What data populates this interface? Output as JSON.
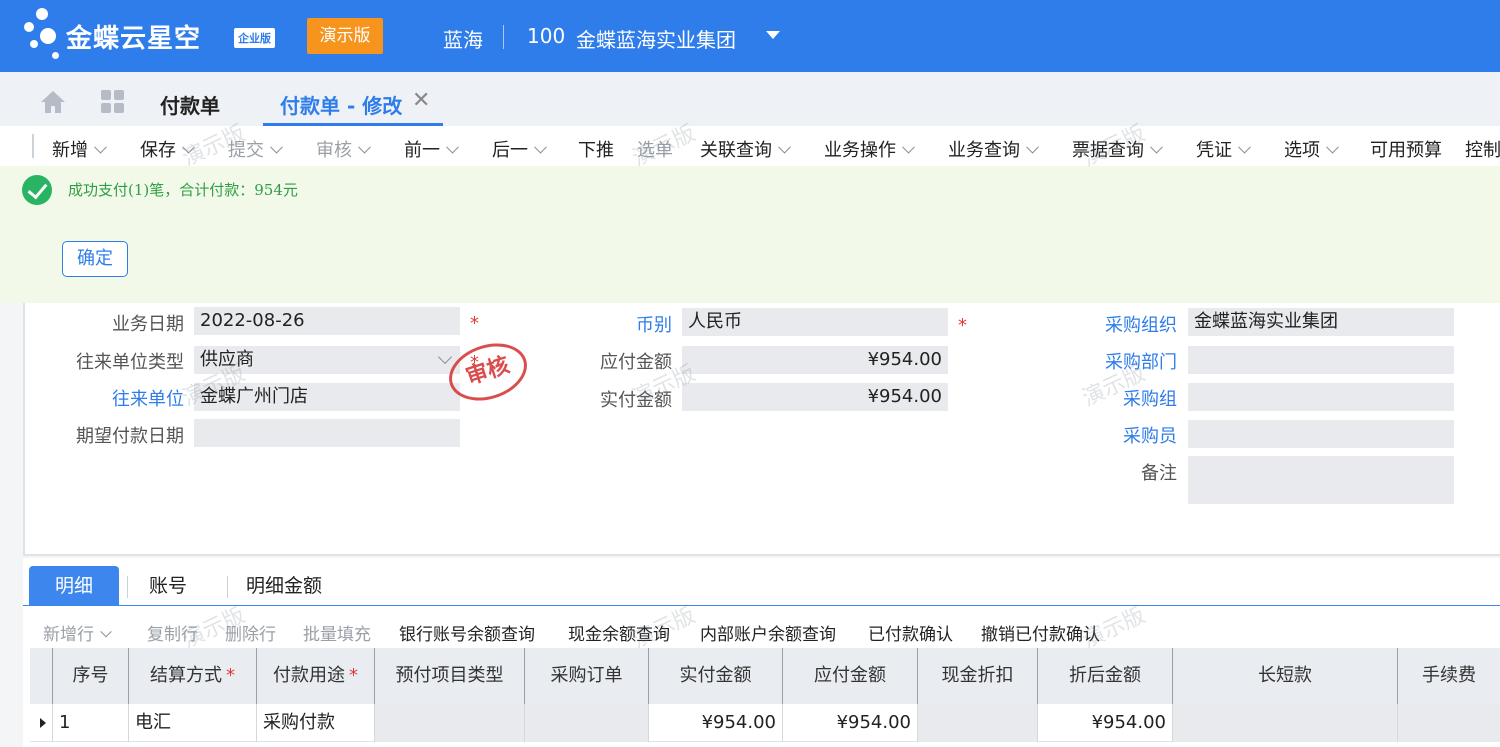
{
  "app": {
    "brand": "金蝶云星空",
    "edition": "企业版",
    "demo_badge": "演示版",
    "user": "蓝海",
    "org_code": "100",
    "org_name": "金蝶蓝海实业集团"
  },
  "tabs": [
    {
      "label": "付款单"
    },
    {
      "label": "付款单 - 修改"
    }
  ],
  "toolbar": [
    {
      "label": "新增",
      "has_menu": true,
      "disabled": false
    },
    {
      "label": "保存",
      "has_menu": true,
      "disabled": false
    },
    {
      "label": "提交",
      "has_menu": true,
      "disabled": true
    },
    {
      "label": "审核",
      "has_menu": true,
      "disabled": true
    },
    {
      "label": "前一",
      "has_menu": true,
      "disabled": false
    },
    {
      "label": "后一",
      "has_menu": true,
      "disabled": false
    },
    {
      "label": "下推",
      "has_menu": false,
      "disabled": false
    },
    {
      "label": "选单",
      "has_menu": false,
      "disabled": true
    },
    {
      "label": "关联查询",
      "has_menu": true,
      "disabled": false
    },
    {
      "label": "业务操作",
      "has_menu": true,
      "disabled": false
    },
    {
      "label": "业务查询",
      "has_menu": true,
      "disabled": false
    },
    {
      "label": "票据查询",
      "has_menu": true,
      "disabled": false
    },
    {
      "label": "凭证",
      "has_menu": true,
      "disabled": false
    },
    {
      "label": "选项",
      "has_menu": true,
      "disabled": false
    },
    {
      "label": "可用预算",
      "has_menu": false,
      "disabled": false
    },
    {
      "label": "控制",
      "has_menu": false,
      "disabled": false
    }
  ],
  "message": {
    "text": "成功支付(1)笔，合计付款：954元",
    "confirm_label": "确定"
  },
  "form": {
    "biz_date_label": "业务日期",
    "biz_date": "2022-08-26",
    "contact_type_label": "往来单位类型",
    "contact_type": "供应商",
    "contact_label": "往来单位",
    "contact": "金蝶广州门店",
    "expected_pay_date_label": "期望付款日期",
    "expected_pay_date": "",
    "currency_label": "币别",
    "currency": "人民币",
    "payable_label": "应付金额",
    "payable": "¥954.00",
    "paid_label": "实付金额",
    "paid": "¥954.00",
    "purchase_org_label": "采购组织",
    "purchase_org": "金蝶蓝海实业集团",
    "purchase_dept_label": "采购部门",
    "purchase_dept": "",
    "purchase_group_label": "采购组",
    "purchase_group": "",
    "buyer_label": "采购员",
    "buyer": "",
    "remark_label": "备注",
    "remark": "",
    "required_mark": "*",
    "stamp": "审核"
  },
  "detail": {
    "tabs": [
      "明细",
      "账号",
      "明细金额"
    ],
    "tools": [
      {
        "label": "新增行",
        "has_menu": true,
        "disabled": true
      },
      {
        "label": "复制行",
        "has_menu": false,
        "disabled": true
      },
      {
        "label": "删除行",
        "has_menu": false,
        "disabled": true
      },
      {
        "label": "批量填充",
        "has_menu": false,
        "disabled": true
      },
      {
        "label": "银行账号余额查询",
        "has_menu": false,
        "disabled": false
      },
      {
        "label": "现金余额查询",
        "has_menu": false,
        "disabled": false
      },
      {
        "label": "内部账户余额查询",
        "has_menu": false,
        "disabled": false
      },
      {
        "label": "已付款确认",
        "has_menu": false,
        "disabled": false
      },
      {
        "label": "撤销已付款确认",
        "has_menu": false,
        "disabled": false
      }
    ],
    "columns": [
      {
        "label": "序号",
        "required": false
      },
      {
        "label": "结算方式",
        "required": true
      },
      {
        "label": "付款用途",
        "required": true
      },
      {
        "label": "预付项目类型",
        "required": false
      },
      {
        "label": "采购订单",
        "required": false
      },
      {
        "label": "实付金额",
        "required": false
      },
      {
        "label": "应付金额",
        "required": false
      },
      {
        "label": "现金折扣",
        "required": false
      },
      {
        "label": "折后金额",
        "required": false
      },
      {
        "label": "长短款",
        "required": false
      },
      {
        "label": "手续费",
        "required": false
      }
    ],
    "rows": [
      [
        "1",
        "电汇",
        "采购付款",
        "",
        "",
        "¥954.00",
        "¥954.00",
        "",
        "¥954.00",
        "",
        ""
      ]
    ]
  },
  "watermark": "演示版",
  "colors": {
    "brand_blue": "#2f7dea",
    "demo_orange": "#f7941d",
    "success_green": "#28b463",
    "required_red": "#e53935"
  }
}
